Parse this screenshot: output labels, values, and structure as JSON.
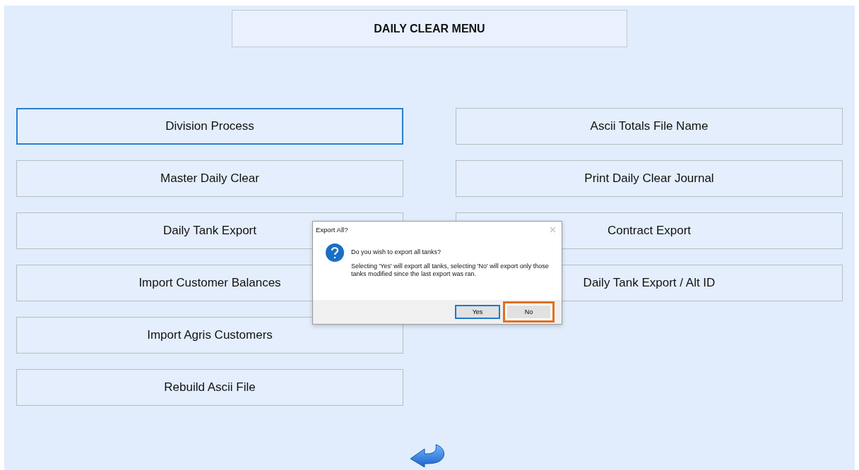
{
  "title": "DAILY CLEAR MENU",
  "left_buttons": [
    {
      "label": "Division Process",
      "focused": true
    },
    {
      "label": "Master Daily Clear",
      "focused": false
    },
    {
      "label": "Daily Tank Export",
      "focused": false
    },
    {
      "label": "Import Customer Balances",
      "focused": false
    },
    {
      "label": "Import Agris Customers",
      "focused": false
    },
    {
      "label": "Rebuild Ascii File",
      "focused": false
    }
  ],
  "right_buttons": [
    {
      "label": "Ascii Totals File Name",
      "focused": false
    },
    {
      "label": "Print Daily Clear Journal",
      "focused": false
    },
    {
      "label": "Contract Export",
      "focused": false
    },
    {
      "label": "Daily Tank Export / Alt ID",
      "focused": false
    }
  ],
  "dialog": {
    "title": "Export All?",
    "question": "Do you wish to export all tanks?",
    "message": "Selecting 'Yes' will export all tanks, selecting 'No' will export only those tanks modified since the last export was ran.",
    "buttons": [
      {
        "label": "Yes",
        "default": true,
        "highlighted": false
      },
      {
        "label": "No",
        "default": false,
        "highlighted": true
      }
    ]
  }
}
